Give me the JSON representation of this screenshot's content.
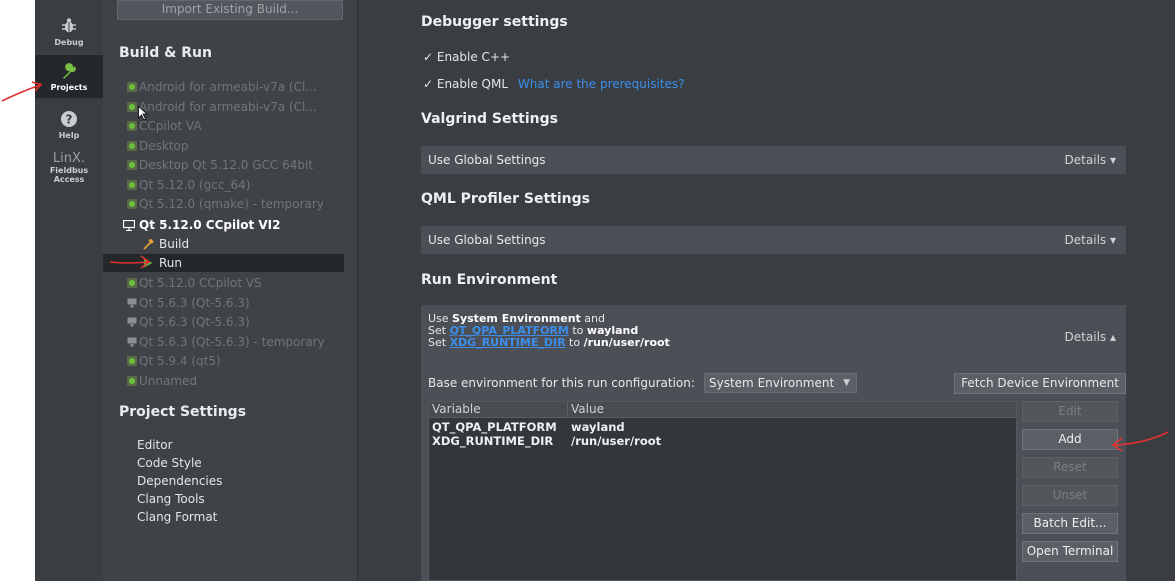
{
  "modes": [
    {
      "label": "Debug",
      "icon": "bug-icon",
      "active": false
    },
    {
      "label": "Projects",
      "icon": "wrench-icon",
      "active": true
    },
    {
      "label": "Help",
      "icon": "help-icon",
      "active": false
    },
    {
      "label_logo": "LinX.",
      "label1": "Fieldbus",
      "label2": "Access",
      "icon": "linx-logo"
    }
  ],
  "projects": {
    "import_button": "Import Existing Build...",
    "build_run_title": "Build & Run",
    "kits": [
      "Android for armeabi-v7a (Cl...",
      "Android for armeabi-v7a (Cl...",
      "CCpilot VA",
      "Desktop",
      "Desktop Qt 5.12.0 GCC 64bit",
      "Qt 5.12.0 (gcc_64)",
      "Qt 5.12.0 (qmake) - temporary"
    ],
    "active_kit": "Qt 5.12.0 CCpilot VI2",
    "build_label": "Build",
    "run_label": "Run",
    "more_kits": [
      "Qt 5.12.0 CCpilot VS",
      "Qt 5.6.3 (Qt-5.6.3)",
      "Qt 5.6.3 (Qt-5.6.3)",
      "Qt 5.6.3 (Qt-5.6.3) - temporary",
      "Qt 5.9.4 (qt5)",
      "Unnamed"
    ],
    "project_settings_title": "Project Settings",
    "settings_items": [
      "Editor",
      "Code Style",
      "Dependencies",
      "Clang Tools",
      "Clang Format"
    ]
  },
  "main": {
    "debugger_title": "Debugger settings",
    "enable_cpp": "✓ Enable C++",
    "enable_qml": "✓ Enable QML",
    "prereq_link": "What are the prerequisites?",
    "valgrind_title": "Valgrind Settings",
    "valgrind_value": "Use Global Settings",
    "details": "Details ▾",
    "details_open": "Details ▴",
    "qml_profiler_title": "QML Profiler Settings",
    "qml_profiler_value": "Use Global Settings",
    "run_env_title": "Run Environment",
    "summary": {
      "l1_a": "Use ",
      "l1_b": "System Environment",
      "l1_c": " and",
      "l2_a": "Set ",
      "l2_var": "QT_QPA_PLATFORM",
      "l2_b": " to ",
      "l2_val": "wayland",
      "l3_a": "Set ",
      "l3_var": "XDG_RUNTIME_DIR",
      "l3_b": " to ",
      "l3_val": "/run/user/root"
    },
    "base_env_label": "Base environment for this run configuration:",
    "base_env_value": "System Environment",
    "fetch_button": "Fetch Device Environment",
    "table": {
      "col_variable": "Variable",
      "col_value": "Value",
      "rows": [
        {
          "variable": "QT_QPA_PLATFORM",
          "value": "wayland"
        },
        {
          "variable": "XDG_RUNTIME_DIR",
          "value": "/run/user/root"
        }
      ]
    },
    "buttons": {
      "edit": "Edit",
      "add": "Add",
      "reset": "Reset",
      "unset": "Unset",
      "batch_edit": "Batch Edit...",
      "open_terminal": "Open Terminal"
    }
  },
  "colors": {
    "accent_link": "#3b8eea",
    "kit_ok_green": "#5fa83a",
    "annotation_red": "#e03030"
  }
}
